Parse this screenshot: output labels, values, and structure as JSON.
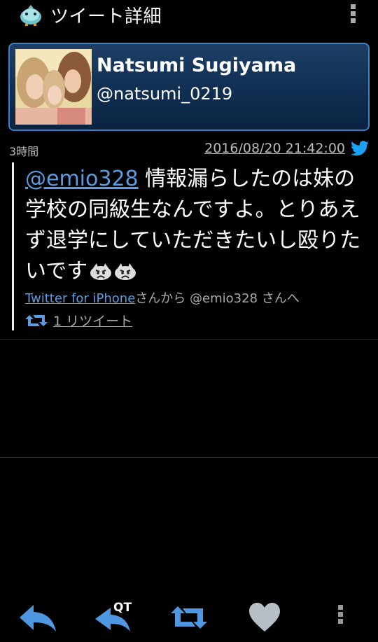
{
  "actionbar": {
    "title": "ツイート詳細",
    "app_icon": "bird-app-icon",
    "menu_icon": "overflow-menu-icon"
  },
  "user": {
    "display_name": "Natsumi Sugiyama",
    "screen_name": "@natsumi_0219",
    "avatar": "profile-photo"
  },
  "tweet": {
    "elapsed": "3時間",
    "timestamp": "2016/08/20 21:42:00",
    "mention": "@emio328",
    "text": " 情報漏らしたのは妹の学校の同級生なんですよ。とりあえず退学にしていただきたいし殴りたいです",
    "emoji": [
      "angry-face-icon",
      "angry-face-icon"
    ],
    "client": "Twitter for iPhone",
    "via_suffix": "さんから @emio328 さんへ",
    "retweet_count": "1 リツイート"
  },
  "toolbar": {
    "items": [
      "reply-icon",
      "quote-tweet-icon",
      "retweet-icon",
      "favorite-heart-icon",
      "overflow-menu-icon"
    ],
    "quote_label": "QT"
  },
  "colors": {
    "background": "#000000",
    "link": "#5b9bde",
    "card_border": "#3f7fc4",
    "card_fill": "#123156",
    "twitter_blue": "#1da1f2"
  }
}
